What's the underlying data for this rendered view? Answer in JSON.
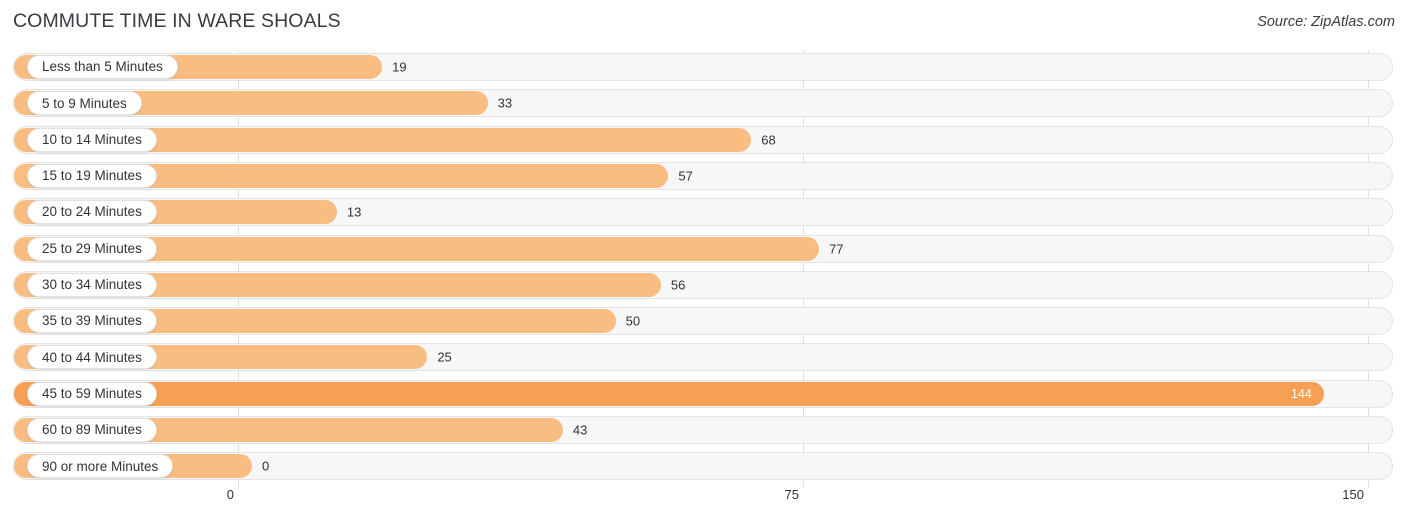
{
  "header": {
    "title": "COMMUTE TIME IN WARE SHOALS",
    "source": "Source: ZipAtlas.com"
  },
  "colors": {
    "bar": "#f9bc81",
    "bar_highlight": "#f7a053",
    "track": "#f7f7f7",
    "gridline": "#dedede",
    "text": "#33333b"
  },
  "chart_data": {
    "type": "bar",
    "orientation": "horizontal",
    "title": "COMMUTE TIME IN WARE SHOALS",
    "subtitle": "",
    "xlabel": "",
    "ylabel": "",
    "xlim": [
      0,
      150
    ],
    "xticks": [
      0,
      75,
      150
    ],
    "xtick_labels": [
      "0",
      "75",
      "150"
    ],
    "grid": true,
    "legend": null,
    "highlight_category": "45 to 59 Minutes",
    "categories": [
      "Less than 5 Minutes",
      "5 to 9 Minutes",
      "10 to 14 Minutes",
      "15 to 19 Minutes",
      "20 to 24 Minutes",
      "25 to 29 Minutes",
      "30 to 34 Minutes",
      "35 to 39 Minutes",
      "40 to 44 Minutes",
      "45 to 59 Minutes",
      "60 to 89 Minutes",
      "90 or more Minutes"
    ],
    "values": [
      19,
      33,
      68,
      57,
      13,
      77,
      56,
      50,
      25,
      144,
      43,
      0
    ],
    "value_labels": [
      "19",
      "33",
      "68",
      "57",
      "13",
      "77",
      "56",
      "50",
      "25",
      "144",
      "43",
      "0"
    ]
  }
}
